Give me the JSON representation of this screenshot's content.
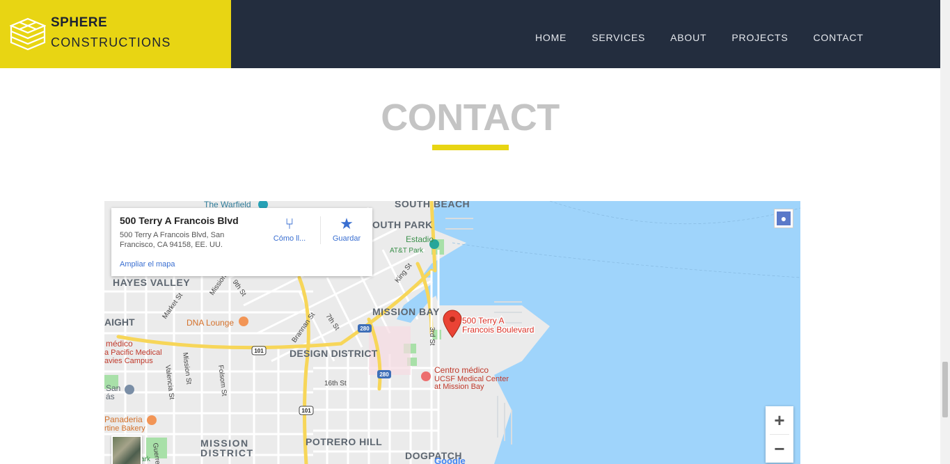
{
  "logo": {
    "line1": "SPHERE",
    "line2": "CONSTRUCTIONS"
  },
  "nav": {
    "items": [
      "HOME",
      "SERVICES",
      "ABOUT",
      "PROJECTS",
      "CONTACT"
    ]
  },
  "section": {
    "title": "CONTACT"
  },
  "colors": {
    "accent": "#e8d513",
    "header_bg": "#232d3e",
    "water": "#9fd4fb",
    "pin": "#ea4335"
  },
  "map": {
    "card": {
      "title": "500 Terry A Francois Blvd",
      "address": "500 Terry A Francois Blvd, San Francisco, CA 94158, EE. UU.",
      "directions_label": "Cómo ll...",
      "save_label": "Guardar",
      "enlarge_link": "Ampliar el mapa"
    },
    "marker": {
      "label_line1": "500 Terry A",
      "label_line2": "Francois Boulevard"
    },
    "labels": {
      "warfield": "The Warfield",
      "south_beach": "SOUTH BEACH",
      "south_park": "OUTH PARK",
      "estadio": "Estadio",
      "att_park": "AT&T Park",
      "hayes_valley": "HAYES VALLEY",
      "mission_bay": "MISSION BAY",
      "aight": "AIGHT",
      "dna_lounge": "DNA Lounge",
      "medico": "médico",
      "pacific_medical": "a Pacific Medical",
      "davies_campus": "avies Campus",
      "design_district": "DESIGN DISTRICT",
      "centro_medico": "Centro médico",
      "ucsf": "UCSF Medical Center",
      "at_mission_bay": "at Mission Bay",
      "san": "San",
      "fs": "ás",
      "sixteenth": "16th St",
      "panaderia": "Panaderia",
      "bakery": "rtine Bakery",
      "mission": "MISSION",
      "district": "DISTRICT",
      "potrero_hill": "POTRERO HILL",
      "dogpatch": "DOGPATCH",
      "king_st": "King St",
      "market_st": "Market St",
      "mission_st": "Mission St",
      "valencia_st": "Valencia St",
      "folsom_st": "Folsom St",
      "brannan_st": "Brannan St",
      "seventh_st": "7th St",
      "third_st": "3rd St",
      "ninth_st": "9th St",
      "mission_street_small": "Mission",
      "guerrero": "Guerre",
      "park": "ark",
      "shield_280a": "280",
      "shield_280b": "280",
      "shield_101a": "101",
      "shield_101b": "101",
      "google": "Google"
    },
    "zoom_in": "+",
    "zoom_out": "−"
  }
}
